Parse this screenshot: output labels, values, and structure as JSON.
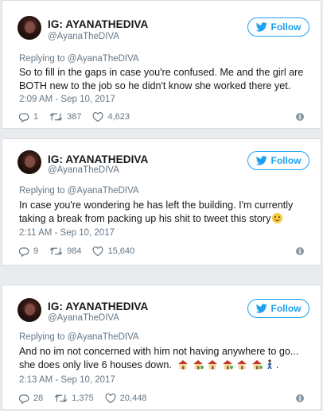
{
  "tweets": [
    {
      "display_name": "IG: AYANATHEDIVA",
      "handle": "@AyanaTheDIVA",
      "follow_label": "Follow",
      "reply_context": "Replying to @AyanaTheDIVA",
      "text": "So to fill in the gaps in case you're confused. Me and the girl are BOTH new to the job so he didn't know she worked there yet.",
      "timestamp": "2:09 AM - Sep 10, 2017",
      "replies": "1",
      "retweets": "387",
      "likes": "4,623"
    },
    {
      "display_name": "IG: AYANATHEDIVA",
      "handle": "@AyanaTheDIVA",
      "follow_label": "Follow",
      "reply_context": "Replying to @AyanaTheDIVA",
      "text": "In case you're wondering he has left the building. I'm currently taking a break from packing up his shit to tweet this story",
      "timestamp": "2:11 AM - Sep 10, 2017",
      "replies": "9",
      "retweets": "984",
      "likes": "15,640"
    },
    {
      "display_name": "IG: AYANATHEDIVA",
      "handle": "@AyanaTheDIVA",
      "follow_label": "Follow",
      "reply_context": "Replying to @AyanaTheDIVA",
      "text_line1": "And no im not concerned with him not having anywhere to go...",
      "text_line2": "she does only live 6 houses down.",
      "text_end": ".",
      "timestamp": "2:13 AM - Sep 10, 2017",
      "replies": "28",
      "retweets": "1,375",
      "likes": "20,448"
    }
  ],
  "colors": {
    "accent": "#1da1f2",
    "muted": "#657786",
    "background": "#e9ecef"
  },
  "icons": [
    "twitter-bird-icon",
    "reply-icon",
    "retweet-icon",
    "heart-icon",
    "info-icon",
    "smiley-emoji",
    "house-emoji",
    "walking-person-emoji"
  ]
}
